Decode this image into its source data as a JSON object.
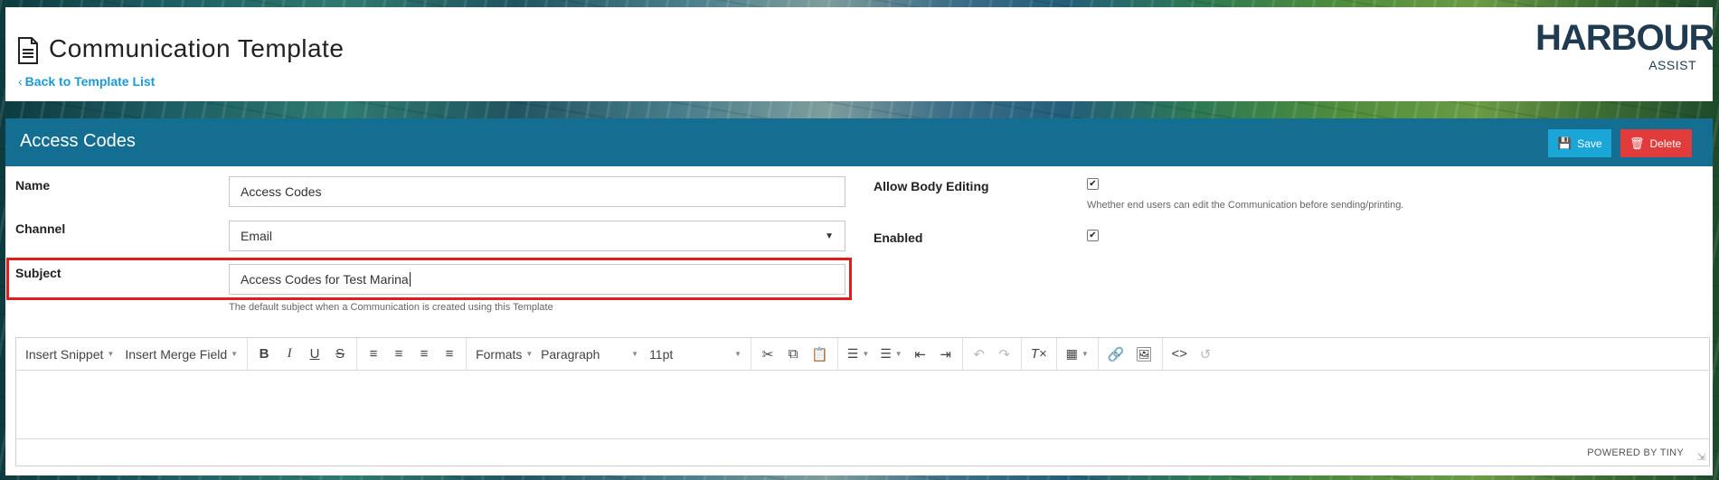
{
  "header": {
    "title": "Communication Template",
    "back_link": "Back to Template List",
    "logo_main": "HARBOUR",
    "logo_sub": "ASSIST"
  },
  "panel": {
    "title": "Access Codes",
    "save_label": "Save",
    "delete_label": "Delete"
  },
  "form": {
    "name_label": "Name",
    "name_value": "Access Codes",
    "channel_label": "Channel",
    "channel_value": "Email",
    "subject_label": "Subject",
    "subject_value": "Access Codes for Test Marina",
    "subject_help": "The default subject when a Communication is created using this Template",
    "allow_body_label": "Allow Body Editing",
    "allow_body_checked": true,
    "allow_body_help": "Whether end users can edit the Communication before sending/printing.",
    "enabled_label": "Enabled",
    "enabled_checked": true
  },
  "editor": {
    "insert_snippet": "Insert Snippet",
    "insert_merge_field": "Insert Merge Field",
    "formats": "Formats",
    "paragraph": "Paragraph",
    "font_size": "11pt",
    "powered_by": "POWERED BY TINY"
  },
  "colors": {
    "header_bar": "#136e91",
    "save_button": "#1aa7d8",
    "delete_button": "#e23b3b",
    "link": "#1a9bd7",
    "highlight": "#e11d1d"
  }
}
